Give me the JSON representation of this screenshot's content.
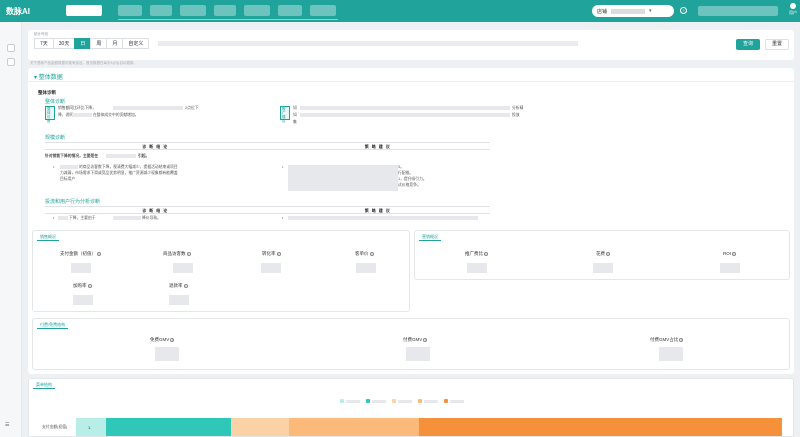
{
  "app": {
    "name": "数脉AI"
  },
  "header": {
    "shop_label": "店铺",
    "user_label": "用户"
  },
  "filter": {
    "label": "统计时段",
    "ranges": [
      "7天",
      "30天",
      "日",
      "周",
      "月",
      "自定义"
    ],
    "active_range": "日",
    "query_label": "查询",
    "reset_label": "重置"
  },
  "note": "关于退款产品金额数据可能有延迟。首页数据在每天8点后自动更新。",
  "overall": {
    "title": "整体数据",
    "diag_head": "整体诊断",
    "overall_diag_title": "整体诊断",
    "tag_label": "整体诊断",
    "tag_label2": "推广建议",
    "diag_line1": "销售额同比环比下降，",
    "diag_line1b": "2点位下",
    "diag_line2": "降，说明",
    "diag_line2b": "在整体成交中的贡献增加。",
    "right_line1": "如",
    "right_line1b": "分析精",
    "right_line2": "如",
    "right_line2b": "投放",
    "right_line3": "集",
    "scale_title": "规模诊断",
    "table_col1": "诊断结论",
    "table_col2": "策略建议",
    "scale_line": "针对销售下降的情况，主要是在",
    "scale_line_b": "引起。",
    "bullet1a": "的商品访客数下降，视清费大幅减少，提据活动结束或项目",
    "bullet1b": "力减弱，市场需求下滑或竞品优势明显，推广资源减少现象都有能覆盖",
    "bullet1c": "目标用户",
    "advice1": "3。",
    "advice2": "行配推。",
    "advice3": "1，提升吸引力。",
    "advice4": "试价格竞争。",
    "behavior_title": "投流和用户行为分析诊断",
    "behavior_line": "下降，主要由于",
    "behavior_line_b": "降价导致。"
  },
  "sales": {
    "title": "销售概况",
    "metrics": [
      "支付金额（初值）",
      "商品访客数",
      "转化率",
      "客单价",
      "加购率",
      "退款率"
    ]
  },
  "marketing": {
    "title": "营销概况",
    "metrics": [
      "推广费比",
      "花费",
      "ROI"
    ]
  },
  "gmv": {
    "title": "付费/免费结构",
    "metrics": [
      "免费GMV",
      "付费GMV",
      "付费GMV占比"
    ]
  },
  "ad_structure": {
    "title": "菜单结构",
    "row_label": "支付金额(初值)",
    "first_segment_prefix": "1.",
    "colors": [
      "#b8eee8",
      "#2ec7b8",
      "#fbd1a6",
      "#fbb97a",
      "#f6913b"
    ]
  }
}
